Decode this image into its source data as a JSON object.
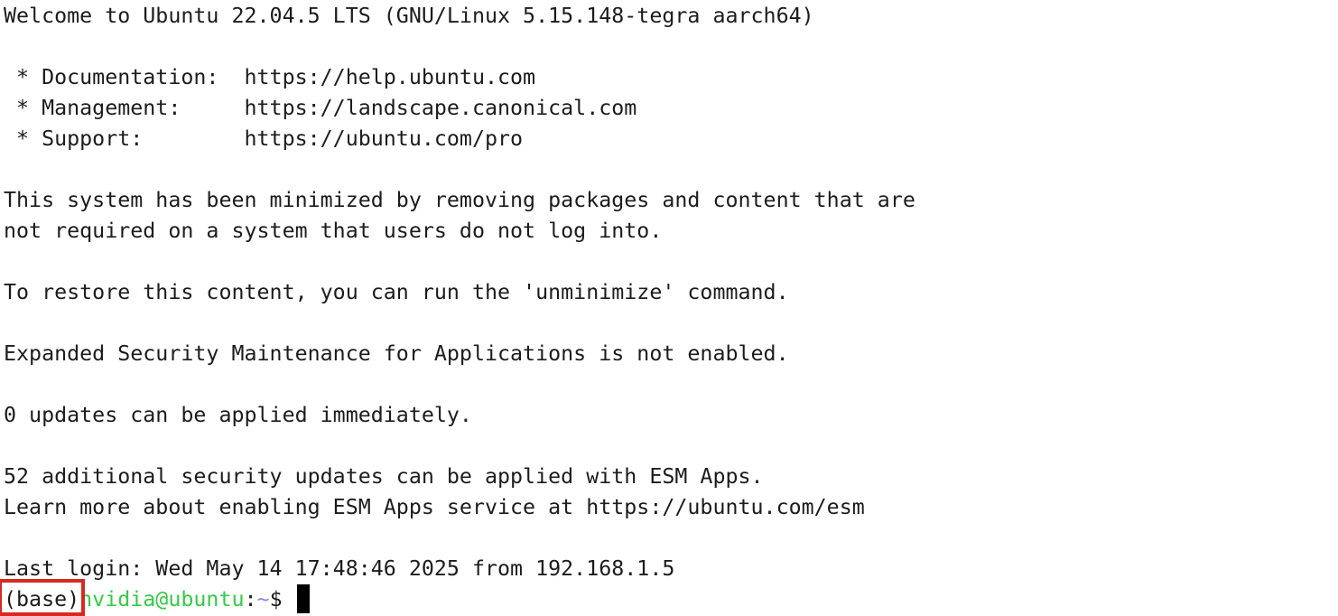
{
  "terminal": {
    "welcome": "Welcome to Ubuntu 22.04.5 LTS (GNU/Linux 5.15.148-tegra aarch64)",
    "docs": " * Documentation:  https://help.ubuntu.com",
    "management": " * Management:     https://landscape.canonical.com",
    "support": " * Support:        https://ubuntu.com/pro",
    "minimized_1": "This system has been minimized by removing packages and content that are",
    "minimized_2": "not required on a system that users do not log into.",
    "restore": "To restore this content, you can run the 'unminimize' command.",
    "esm_status": "Expanded Security Maintenance for Applications is not enabled.",
    "updates": "0 updates can be applied immediately.",
    "security_updates": "52 additional security updates can be applied with ESM Apps.",
    "learn_more": "Learn more about enabling ESM Apps service at https://ubuntu.com/esm",
    "last_login": "Last login: Wed May 14 17:48:46 2025 from 192.168.1.5"
  },
  "prompt": {
    "env": "(base)",
    "user_host": "nvidia@ubuntu",
    "separator": ":",
    "path": "~",
    "symbol": "$ "
  },
  "colors": {
    "highlight_box": "#d42a22",
    "user_host": "#36c94a",
    "path": "#8a86e8",
    "text": "#1c1c1c",
    "background": "#ffffff"
  }
}
